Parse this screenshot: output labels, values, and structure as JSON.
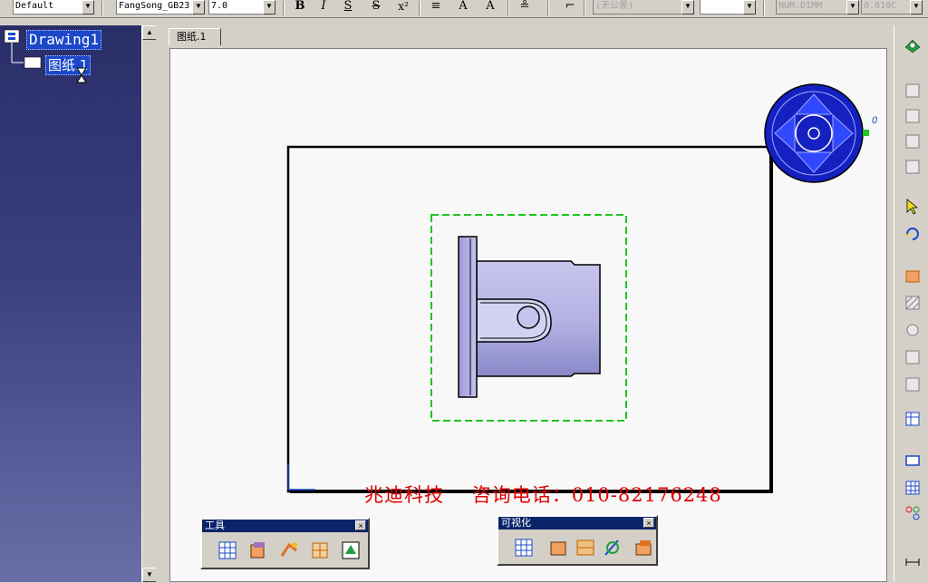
{
  "toolbar": {
    "style_value": "Default",
    "font_value": "FangSong_GB23",
    "size_value": "7.0",
    "bold": "B",
    "italic": "I",
    "underline": "S",
    "strike": "S",
    "superscript": "x²",
    "tolerance_value": "(无公差)",
    "format_value": "NUM.DIMM",
    "precision_value": "0.010C"
  },
  "tree": {
    "root_label": "Drawing1",
    "child_label": "图纸.1"
  },
  "sheet_tab_label": "图纸.1",
  "compass_label": "0",
  "watermark": {
    "company": "兆迪科技",
    "contact": "咨询电话：010-82176248"
  },
  "palettes": {
    "tools": {
      "title": "工具",
      "close": "×"
    },
    "visual": {
      "title": "可视化",
      "close": "×"
    }
  },
  "colors": {
    "tree_bg": "#2a2e68",
    "selection": "#1a48c8",
    "view_frame": "#22c422",
    "part_fill": "#b8b6e6",
    "compass": "#1420c0",
    "watermark": "#e00000"
  }
}
